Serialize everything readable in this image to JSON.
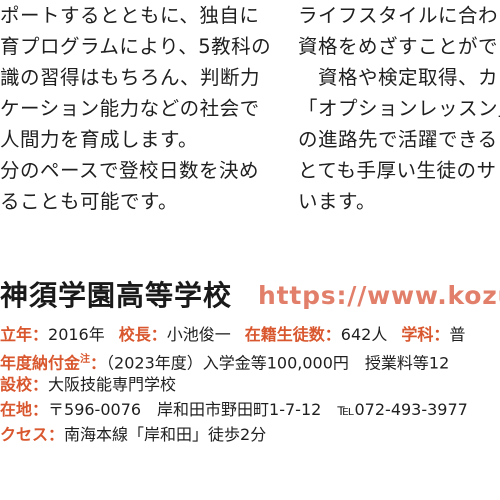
{
  "left_column": {
    "lines": [
      "ポートするとともに、独自に",
      "育プログラムにより、5教科の",
      "識の習得はもちろん、判断力",
      "ケーション能力などの社会で",
      "人間力を育成します。",
      "分のペースで登校日数を決め",
      "ることも可能です。"
    ]
  },
  "right_column": {
    "lines": [
      "ライフスタイルに合わ",
      "資格をめざすことがで",
      "　資格や検定取得、カ",
      "「オプションレッスン」も",
      "の進路先で活躍できる",
      "とても手厚い生徒のサ",
      "います。"
    ]
  },
  "school": {
    "name": "神須学園高等学校",
    "url": "https://www.kozu-g"
  },
  "info": {
    "founded_label": "立年：",
    "founded_value": "2016年",
    "principal_label": "校長：",
    "principal_value": "小池俊一",
    "students_label": "在籍生徒数：",
    "students_value": "642人",
    "dept_label": "学科：",
    "dept_value": "普",
    "fee_label": "年度納付金",
    "fee_note": "注",
    "fee_colon": "：",
    "fee_value": "（2023年度）入学金等100,000円　授業料等12",
    "affiliate_label": "設校：",
    "affiliate_value": "大阪技能専門学校",
    "address_label": "在地：",
    "address_value": "〒596-0076　岸和田市野田町1-7-12　℡072-493-3977",
    "access_label": "クセス：",
    "access_value": "南海本線「岸和田」徒歩2分"
  }
}
